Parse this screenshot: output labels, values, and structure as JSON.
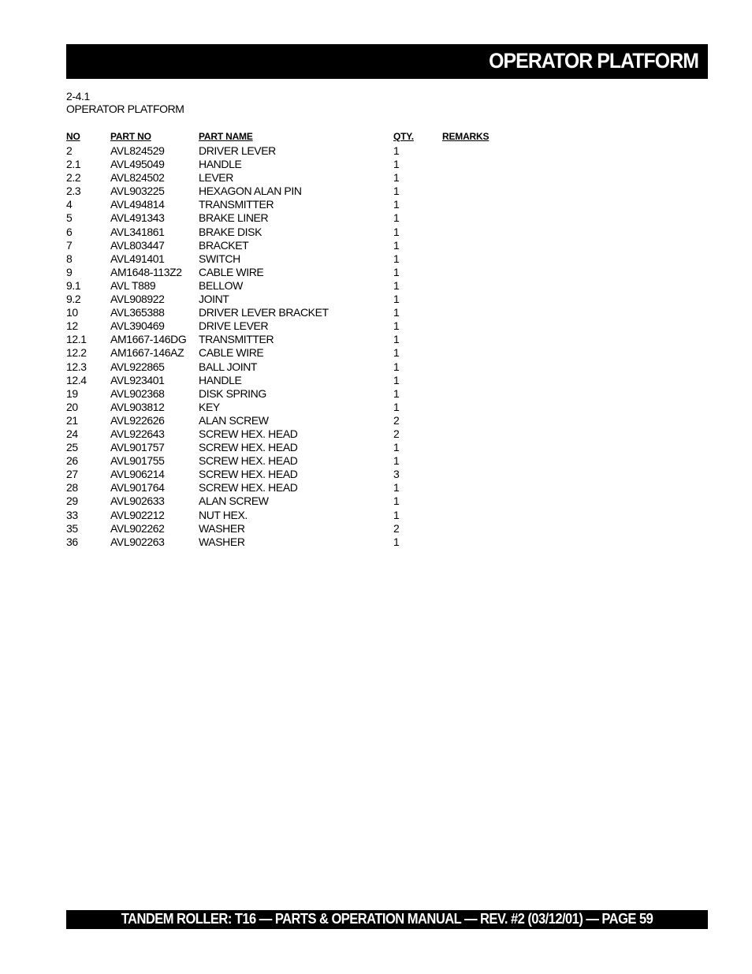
{
  "header": {
    "title": "OPERATOR PLATFORM"
  },
  "section": {
    "number": "2-4.1",
    "title": "OPERATOR PLATFORM"
  },
  "table": {
    "columns": {
      "no": "NO",
      "part_no": "PART NO",
      "part_name": "PART NAME",
      "qty": "QTY.",
      "remarks": "REMARKS"
    },
    "rows": [
      {
        "no": "2",
        "part_no": "AVL824529",
        "part_name": "DRIVER LEVER",
        "qty": "1",
        "remarks": ""
      },
      {
        "no": "2.1",
        "part_no": "AVL495049",
        "part_name": "HANDLE",
        "qty": "1",
        "remarks": ""
      },
      {
        "no": "2.2",
        "part_no": "AVL824502",
        "part_name": "LEVER",
        "qty": "1",
        "remarks": ""
      },
      {
        "no": "2.3",
        "part_no": "AVL903225",
        "part_name": "HEXAGON ALAN PIN",
        "qty": "1",
        "remarks": ""
      },
      {
        "no": "4",
        "part_no": "AVL494814",
        "part_name": "TRANSMITTER",
        "qty": "1",
        "remarks": ""
      },
      {
        "no": "5",
        "part_no": "AVL491343",
        "part_name": "BRAKE LINER",
        "qty": "1",
        "remarks": ""
      },
      {
        "no": "6",
        "part_no": "AVL341861",
        "part_name": "BRAKE DISK",
        "qty": "1",
        "remarks": ""
      },
      {
        "no": "7",
        "part_no": "AVL803447",
        "part_name": "BRACKET",
        "qty": "1",
        "remarks": ""
      },
      {
        "no": "8",
        "part_no": "AVL491401",
        "part_name": "SWITCH",
        "qty": "1",
        "remarks": ""
      },
      {
        "no": "9",
        "part_no": "AM1648-113Z2",
        "part_name": "CABLE WIRE",
        "qty": "1",
        "remarks": ""
      },
      {
        "no": "9.1",
        "part_no": "AVL T889",
        "part_name": "BELLOW",
        "qty": "1",
        "remarks": ""
      },
      {
        "no": "9.2",
        "part_no": "AVL908922",
        "part_name": "JOINT",
        "qty": "1",
        "remarks": ""
      },
      {
        "no": "10",
        "part_no": "AVL365388",
        "part_name": "DRIVER LEVER BRACKET",
        "qty": "1",
        "remarks": ""
      },
      {
        "no": "12",
        "part_no": "AVL390469",
        "part_name": "DRIVE LEVER",
        "qty": "1",
        "remarks": ""
      },
      {
        "no": "12.1",
        "part_no": "AM1667-146DG",
        "part_name": "TRANSMITTER",
        "qty": "1",
        "remarks": ""
      },
      {
        "no": "12.2",
        "part_no": "AM1667-146AZ",
        "part_name": "CABLE WIRE",
        "qty": "1",
        "remarks": ""
      },
      {
        "no": "12.3",
        "part_no": "AVL922865",
        "part_name": "BALL JOINT",
        "qty": "1",
        "remarks": ""
      },
      {
        "no": "12.4",
        "part_no": "AVL923401",
        "part_name": "HANDLE",
        "qty": "1",
        "remarks": ""
      },
      {
        "no": "19",
        "part_no": "AVL902368",
        "part_name": "DISK SPRING",
        "qty": "1",
        "remarks": ""
      },
      {
        "no": "20",
        "part_no": "AVL903812",
        "part_name": "KEY",
        "qty": "1",
        "remarks": ""
      },
      {
        "no": "21",
        "part_no": "AVL922626",
        "part_name": "ALAN SCREW",
        "qty": "2",
        "remarks": ""
      },
      {
        "no": "24",
        "part_no": "AVL922643",
        "part_name": "SCREW HEX. HEAD",
        "qty": "2",
        "remarks": ""
      },
      {
        "no": "25",
        "part_no": "AVL901757",
        "part_name": "SCREW HEX. HEAD",
        "qty": "1",
        "remarks": ""
      },
      {
        "no": "26",
        "part_no": "AVL901755",
        "part_name": "SCREW HEX. HEAD",
        "qty": "1",
        "remarks": ""
      },
      {
        "no": "27",
        "part_no": "AVL906214",
        "part_name": "SCREW HEX. HEAD",
        "qty": "3",
        "remarks": ""
      },
      {
        "no": "28",
        "part_no": "AVL901764",
        "part_name": "SCREW HEX. HEAD",
        "qty": "1",
        "remarks": ""
      },
      {
        "no": "29",
        "part_no": "AVL902633",
        "part_name": "ALAN SCREW",
        "qty": "1",
        "remarks": ""
      },
      {
        "no": "33",
        "part_no": "AVL902212",
        "part_name": "NUT HEX.",
        "qty": "1",
        "remarks": ""
      },
      {
        "no": "35",
        "part_no": "AVL902262",
        "part_name": "WASHER",
        "qty": "2",
        "remarks": ""
      },
      {
        "no": "36",
        "part_no": "AVL902263",
        "part_name": "WASHER",
        "qty": "1",
        "remarks": ""
      }
    ]
  },
  "footer": {
    "text": "TANDEM ROLLER: T16 — PARTS & OPERATION MANUAL — REV. #2 (03/12/01) — PAGE 59"
  }
}
